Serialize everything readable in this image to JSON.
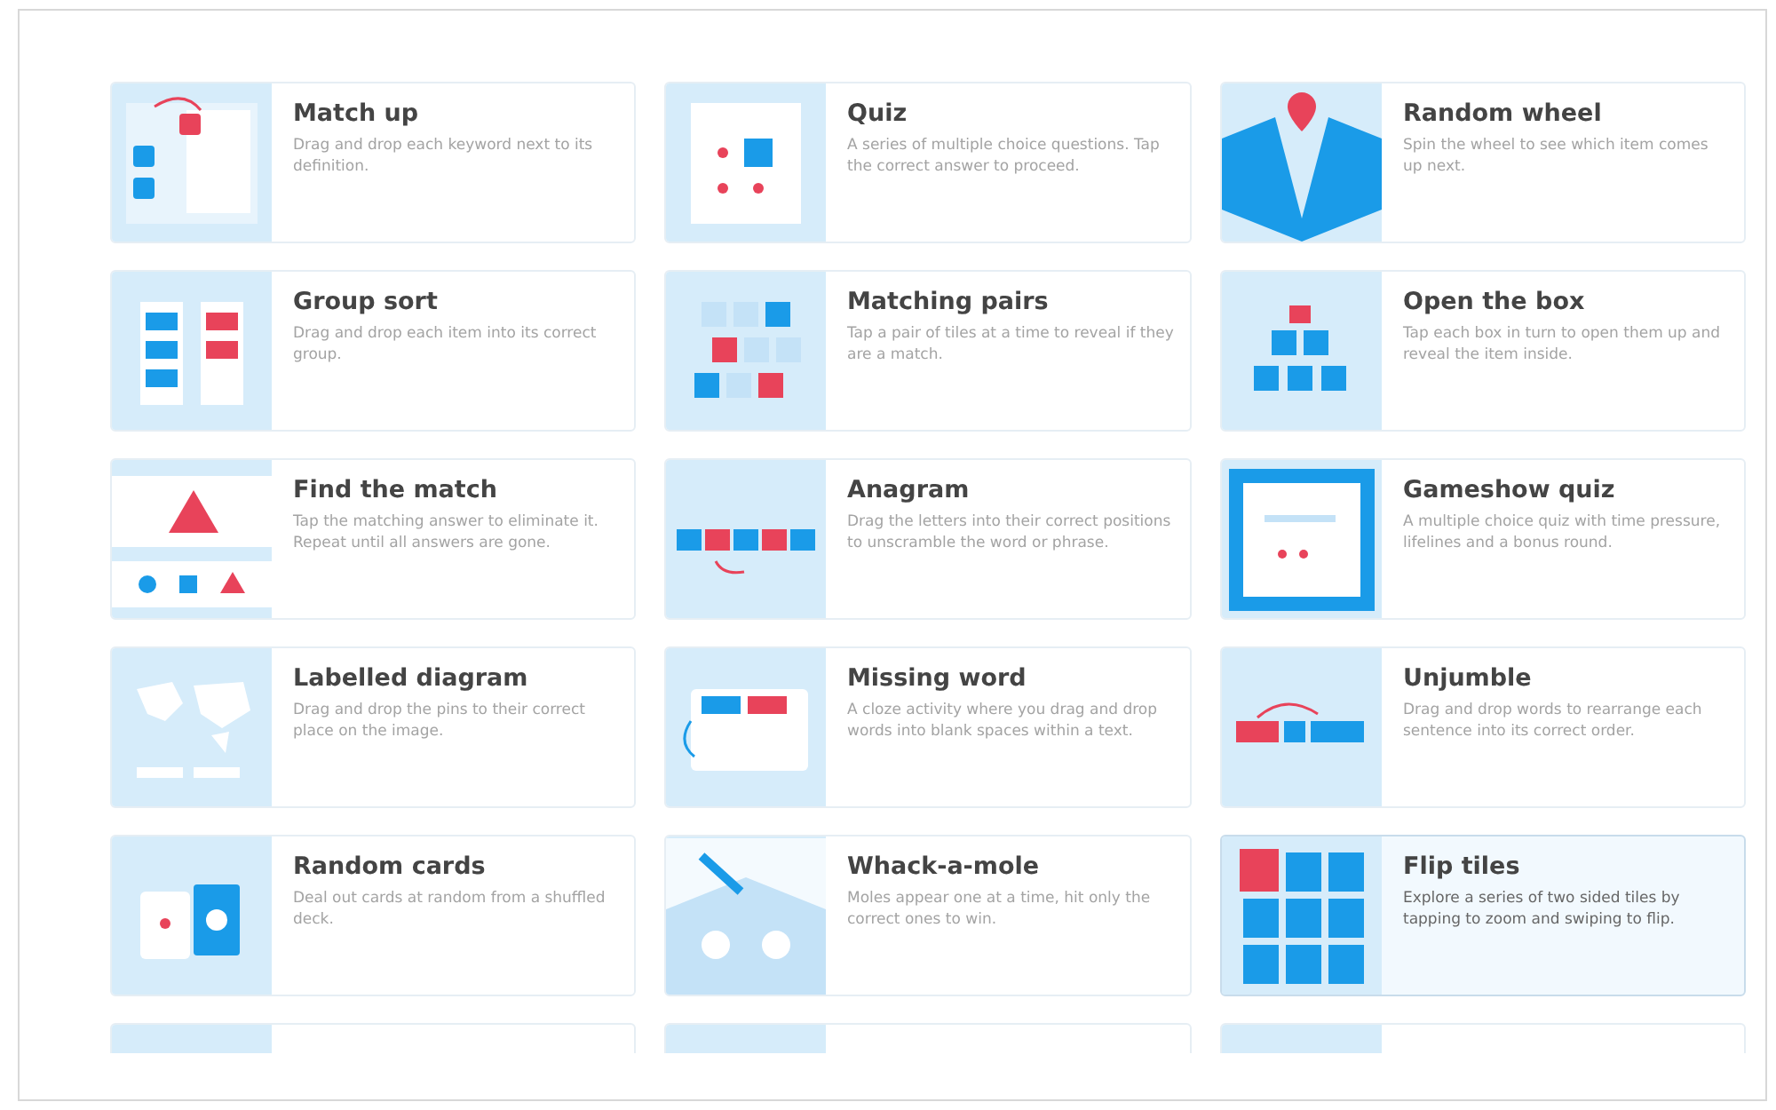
{
  "tiles": [
    {
      "kind": "match-up",
      "title": "Match up",
      "description": "Drag and drop each keyword next to its definition.",
      "selected": false
    },
    {
      "kind": "quiz",
      "title": "Quiz",
      "description": "A series of multiple choice questions. Tap the correct answer to proceed.",
      "selected": false
    },
    {
      "kind": "wheel",
      "title": "Random wheel",
      "description": "Spin the wheel to see which item comes up next.",
      "selected": false
    },
    {
      "kind": "group-sort",
      "title": "Group sort",
      "description": "Drag and drop each item into its correct group.",
      "selected": false
    },
    {
      "kind": "pairs",
      "title": "Matching pairs",
      "description": "Tap a pair of tiles at a time to reveal if they are a match.",
      "selected": false
    },
    {
      "kind": "boxes",
      "title": "Open the box",
      "description": "Tap each box in turn to open them up and reveal the item inside.",
      "selected": false
    },
    {
      "kind": "find",
      "title": "Find the match",
      "description": "Tap the matching answer to eliminate it. Repeat until all answers are gone.",
      "selected": false
    },
    {
      "kind": "anagram",
      "title": "Anagram",
      "description": "Drag the letters into their correct positions to unscramble the word or phrase.",
      "selected": false
    },
    {
      "kind": "gameshow",
      "title": "Gameshow quiz",
      "description": "A multiple choice quiz with time pressure, lifelines and a bonus round.",
      "selected": false
    },
    {
      "kind": "map",
      "title": "Labelled diagram",
      "description": "Drag and drop the pins to their correct place on the image.",
      "selected": false
    },
    {
      "kind": "missing",
      "title": "Missing word",
      "description": "A cloze activity where you drag and drop words into blank spaces within a text.",
      "selected": false
    },
    {
      "kind": "unjumble",
      "title": "Unjumble",
      "description": "Drag and drop words to rearrange each sentence into its correct order.",
      "selected": false
    },
    {
      "kind": "cards",
      "title": "Random cards",
      "description": "Deal out cards at random from a shuffled deck.",
      "selected": false
    },
    {
      "kind": "mole",
      "title": "Whack-a-mole",
      "description": "Moles appear one at a time, hit only the correct ones to win.",
      "selected": false
    },
    {
      "kind": "flip",
      "title": "Flip tiles",
      "description": "Explore a series of two sided tiles by tapping to zoom and swiping to flip.",
      "selected": true
    },
    {
      "kind": "partial",
      "selected": false
    },
    {
      "kind": "partial",
      "selected": false
    },
    {
      "kind": "partial",
      "selected": false
    }
  ]
}
